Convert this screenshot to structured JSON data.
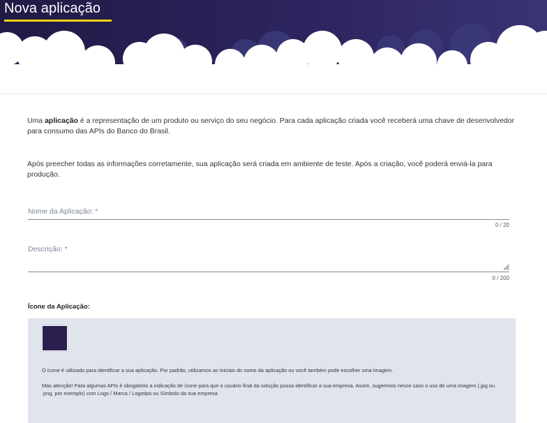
{
  "header": {
    "title": "Nova aplicação",
    "colors": {
      "background": "#2c245e",
      "underline": "#f5d312",
      "cloud": "#ffffff"
    }
  },
  "intro": {
    "prefix": "Uma ",
    "bold": "aplicação",
    "rest": " é a representação de um produto ou serviço do seu negócio. Para cada aplicação criada você receberá uma chave de desenvolvedor para consumo das APIs do Banco do Brasil."
  },
  "info_after": "Após preecher todas as informações corretamente, sua aplicação será criada em ambiente de teste. Após a criação, você poderá enviá-la para produção.",
  "form": {
    "name_field": {
      "label": "Nome da Aplicação: *",
      "value": "",
      "counter": "0 / 20"
    },
    "description_field": {
      "label": "Descrição: *",
      "value": "",
      "counter": "0 / 200"
    }
  },
  "icon_section": {
    "title": "Ícone da Aplicação:",
    "icon_color": "#2a1f4e",
    "note": "O ícone é utilizado para identificar a sua aplicação. Por padrão, utilizamos as iniciais do nome da aplicação ou você também pode escolher uma imagem.",
    "warning": "Mas atenção! Para algumas APIs é obrigatório a indicação de ícone para que o usuário final da solução possa identificar a sua empresa. Assim, sugerimos nesse caso o uso de uma imagem (.jpg ou .png, por exemplo) com Logo / Marca / Logotipo ou Símbolo da sua empresa"
  }
}
